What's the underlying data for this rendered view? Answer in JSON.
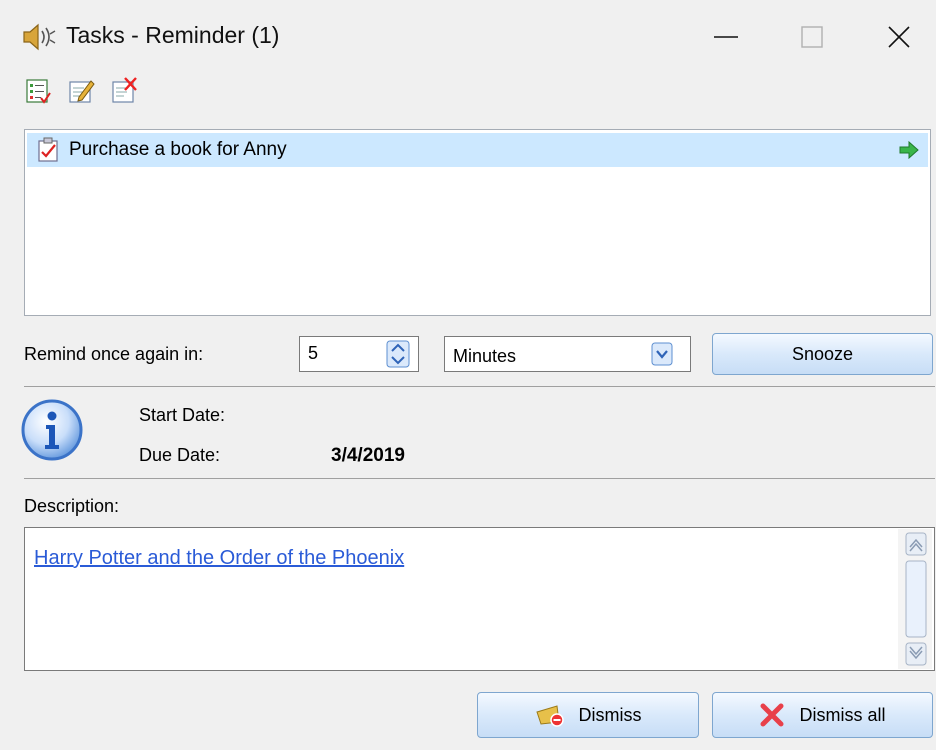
{
  "window": {
    "title": "Tasks - Reminder (1)"
  },
  "toolbar": {
    "items": [
      "checklist-icon",
      "edit-icon",
      "delete-task-icon"
    ]
  },
  "task_list": {
    "items": [
      {
        "label": "Purchase a book for Anny",
        "selected": true
      }
    ]
  },
  "remind": {
    "label": "Remind once again in:",
    "value": "5",
    "unit": "Minutes",
    "snooze_label": "Snooze"
  },
  "details": {
    "start_label": "Start Date:",
    "start_value": "",
    "due_label": "Due Date:",
    "due_value": "3/4/2019"
  },
  "description": {
    "label": "Description:",
    "link_text": "Harry Potter and the Order of the Phoenix"
  },
  "buttons": {
    "dismiss_label": "Dismiss",
    "dismiss_all_label": "Dismiss all"
  },
  "colors": {
    "selection": "#cce8ff",
    "link": "#2a5bd7",
    "button_border": "#7ea6cf"
  }
}
